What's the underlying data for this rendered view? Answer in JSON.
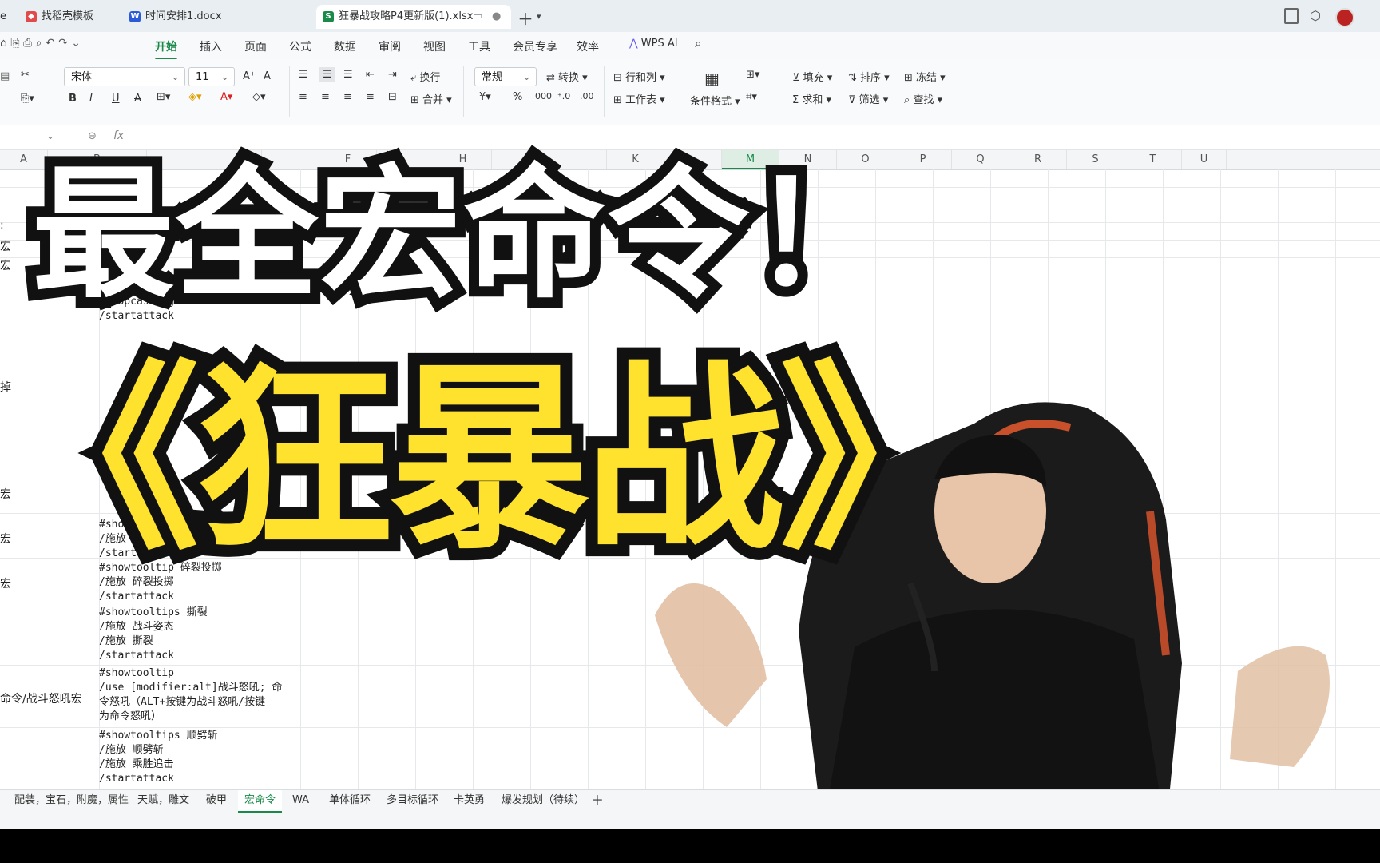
{
  "tabs": [
    {
      "label": "e",
      "icon": ""
    },
    {
      "label": "找稻壳模板",
      "icon": "docer-icon"
    },
    {
      "label": "时间安排1.docx",
      "icon": "word-icon"
    },
    {
      "label": "狂暴战攻略P4更新版(1).xlsx",
      "icon": "sheet-icon"
    }
  ],
  "menu": [
    "开始",
    "插入",
    "页面",
    "公式",
    "数据",
    "审阅",
    "视图",
    "工具",
    "会员专享",
    "效率"
  ],
  "wps_ai": "WPS AI",
  "ribbon": {
    "font_name": "宋体",
    "font_size": "11",
    "wrap": "换行",
    "merge": "合并",
    "number_format": "常规",
    "convert": "转换",
    "rows_cols": "行和列",
    "worksheet": "工作表",
    "cond_format": "条件格式",
    "fill": "填充",
    "sort": "排序",
    "freeze": "冻结",
    "sum": "求和",
    "filter": "筛选",
    "find": "查找"
  },
  "formula": {
    "fx": "fx"
  },
  "columns": [
    "A",
    "B",
    "C",
    "D",
    "E",
    "F",
    "G",
    "H",
    "I",
    "J",
    "K",
    "L",
    "M",
    "N",
    "O",
    "P",
    "Q",
    "R",
    "S",
    "T",
    "U"
  ],
  "col_visible_labels": [
    "A",
    "B",
    "",
    "",
    "",
    "F",
    "",
    "H",
    "",
    "",
    "K",
    "",
    "M",
    "N",
    "O",
    "P",
    "Q",
    "R",
    "S",
    "T",
    "U"
  ],
  "cellsA": [
    ":",
    "宏",
    "宏",
    "掉",
    "宏",
    "宏",
    "宏",
    "命令/战斗怒吼宏"
  ],
  "cellsB": [
    "/stopcasting\n/startattack",
    "#showtooltips 猛击\n/施放 猛击\n/startattack",
    "#showtooltip 碎裂投掷\n/施放 碎裂投掷\n/startattack",
    "#showtooltips 撕裂\n/施放 战斗姿态\n/施放 撕裂\n/startattack",
    "#showtooltip\n/use [modifier:alt]战斗怒吼; 命\n令怒吼（ALT+按键为战斗怒吼/按键\n为命令怒吼）",
    "#showtooltips 顺劈斩\n/施放 顺劈斩\n/施放 乘胜追击\n/startattack"
  ],
  "sheets": [
    "配装，宝石，附魔，属性",
    "天赋，雕文",
    "破甲",
    "宏命令",
    "WA",
    "单体循环",
    "多目标循环",
    "卡英勇",
    "爆发规划（待续）"
  ],
  "active_sheet": "宏命令",
  "overlay": {
    "line1": "最全宏命令！",
    "line2": "《狂暴战》"
  },
  "colors": {
    "accent": "#1a8a4a",
    "title_yellow": "#ffe22e",
    "title_outline": "#111111"
  }
}
